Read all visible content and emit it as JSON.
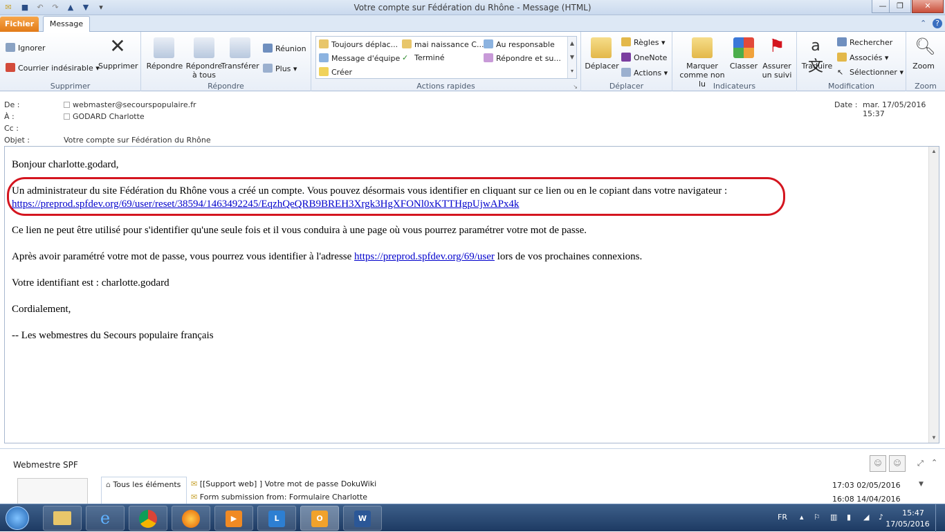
{
  "window": {
    "title": "Votre compte sur Fédération du Rhône  -  Message (HTML)",
    "minimize": "—",
    "maximize": "❐",
    "close": "✕"
  },
  "tabs": {
    "file": "Fichier",
    "message": "Message"
  },
  "ribbon": {
    "supprimer": {
      "ignore": "Ignorer",
      "junk": "Courrier indésirable",
      "delete": "Supprimer",
      "label": "Supprimer"
    },
    "repondre": {
      "reply": "Répondre",
      "reply_all": "Répondre\nà tous",
      "forward": "Transférer",
      "meeting": "Réunion",
      "more": "Plus",
      "label": "Répondre"
    },
    "quick": {
      "items": [
        "Toujours déplac...",
        "Message d'équipe",
        "Créer",
        "mai naissance C...",
        "Terminé",
        "Au responsable",
        "Répondre et su..."
      ],
      "label": "Actions rapides"
    },
    "deplacer": {
      "move": "Déplacer",
      "rules": "Règles",
      "onenote": "OneNote",
      "actions": "Actions",
      "label": "Déplacer"
    },
    "indicateurs": {
      "unread": "Marquer\ncomme non lu",
      "classify": "Classer",
      "followup": "Assurer\nun suivi",
      "label": "Indicateurs"
    },
    "modification": {
      "translate": "Traduire",
      "search": "Rechercher",
      "related": "Associés",
      "select": "Sélectionner",
      "label": "Modification"
    },
    "zoom": {
      "zoom": "Zoom",
      "label": "Zoom"
    }
  },
  "header": {
    "from_label": "De :",
    "from": "webmaster@secourspopulaire.fr",
    "to_label": "À :",
    "to": "GODARD Charlotte",
    "cc_label": "Cc :",
    "subject_label": "Objet :",
    "subject": "Votre compte sur Fédération du Rhône",
    "date_label": "Date :",
    "date": "mar. 17/05/2016 15:37"
  },
  "email": {
    "greeting": "Bonjour charlotte.godard,",
    "para1": "Un administrateur du site Fédération du Rhône vous a créé un compte. Vous pouvez désormais vous identifier en cliquant sur ce lien ou en le copiant dans votre navigateur :",
    "reset_link": "https://preprod.spfdev.org/69/user/reset/38594/1463492245/EqzhQeQRB9BREH3Xrgk3HgXFONl0xKTTHgpUjwAPx4k",
    "para2": "Ce lien ne peut être utilisé pour s'identifier qu'une seule fois et il vous conduira à une page où vous pourrez paramétrer votre mot de passe.",
    "para3_before": "Après avoir paramétré votre mot de passe, vous pourrez vous identifier à l'adresse",
    "user_link": "https://preprod.spfdev.org/69/user",
    "para3_after": "lors de vos prochaines connexions.",
    "login": "Votre identifiant est : charlotte.godard",
    "closing": "Cordialement,",
    "signature": "-- Les webmestres du Secours populaire français"
  },
  "people_pane": {
    "name": "Webmestre SPF",
    "filter": "Tous les éléments",
    "items": [
      {
        "subject": "[[Support web] ] Votre mot de passe DokuWiki",
        "time": "17:03  02/05/2016"
      },
      {
        "subject": "Form submission from: Formulaire Charlotte",
        "time": "16:08  14/04/2016"
      }
    ]
  },
  "taskbar": {
    "lang": "FR",
    "time": "15:47",
    "date": "17/05/2016"
  },
  "colors": {
    "accent": "#e27b18",
    "link": "#0000cc",
    "highlight": "#d4151f"
  }
}
